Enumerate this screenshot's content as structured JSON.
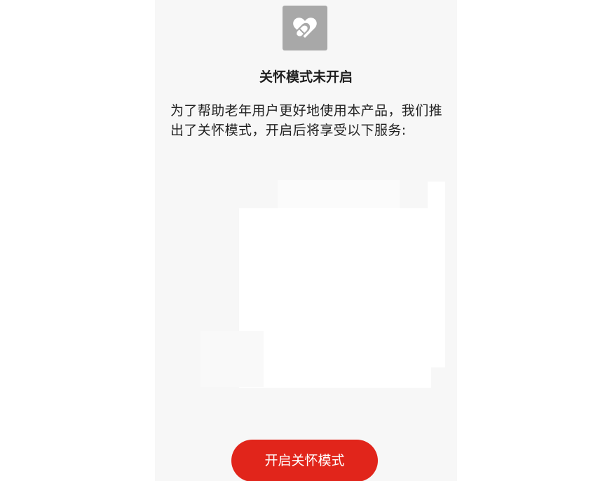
{
  "header": {
    "logo_icon": "heart-pill-icon",
    "title": "关怀模式未开启"
  },
  "description": {
    "text": "为了帮助老年用户更好地使用本产品，我们推出了关怀模式，开启后将享受以下服务:"
  },
  "illustration": {
    "icon": "service-illustration-placeholder"
  },
  "actions": {
    "enable_label": "开启关怀模式"
  },
  "colors": {
    "accent": "#e1251b",
    "logo_bg": "#a8a8a8",
    "background": "#f7f7f7"
  }
}
